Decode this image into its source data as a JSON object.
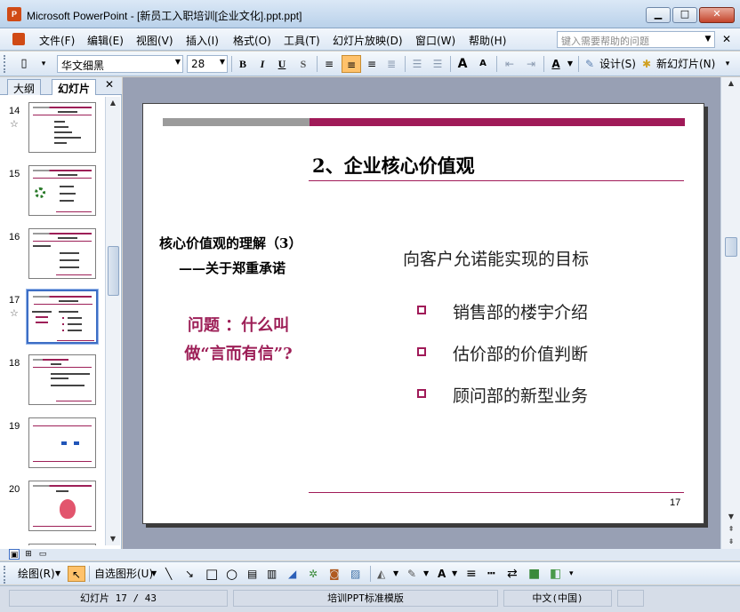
{
  "window": {
    "title": "Microsoft PowerPoint - [新员工入职培训[企业文化].ppt.ppt]",
    "app_icon_text": "P",
    "minimize": "▁",
    "maximize": "□",
    "close": "✕"
  },
  "menu": {
    "items": [
      "文件(F)",
      "编辑(E)",
      "视图(V)",
      "插入(I)",
      "格式(O)",
      "工具(T)",
      "幻灯片放映(D)",
      "窗口(W)",
      "帮助(H)"
    ],
    "help_placeholder": "键入需要帮助的问题",
    "close": "✕"
  },
  "toolbar": {
    "font_name": "华文细黑",
    "font_size": "28",
    "bold": "B",
    "italic": "I",
    "underline": "U",
    "shadow": "S",
    "design_label": "设计(S)",
    "new_slide_label": "新幻灯片(N)",
    "grow_font": "A",
    "shrink_font": "A",
    "font_color": "A"
  },
  "pane": {
    "tab_outline": "大纲",
    "tab_slides": "幻灯片",
    "close": "✕",
    "thumbs": [
      {
        "num": "14",
        "star": "☆"
      },
      {
        "num": "15",
        "star": ""
      },
      {
        "num": "16",
        "star": ""
      },
      {
        "num": "17",
        "star": "☆"
      },
      {
        "num": "18",
        "star": ""
      },
      {
        "num": "19",
        "star": ""
      },
      {
        "num": "20",
        "star": ""
      }
    ]
  },
  "slide": {
    "title": "2、企业核心价值观",
    "left_heading": "核心价值观的理解（3）",
    "left_sub": "——关于郑重承诺",
    "question_line1": "问题 ：什么叫",
    "question_line2": "做“言而有信”?",
    "goal": "向客户允诺能实现的目标",
    "bullets": [
      "销售部的楼宇介绍",
      "估价部的价值判断",
      "顾问部的新型业务"
    ],
    "page_number": "17"
  },
  "drawbar": {
    "draw_label": "绘图(R)",
    "autoshapes_label": "自选图形(U)"
  },
  "status": {
    "slide_info": "幻灯片 17 / 43",
    "template": "培训PPT标准模版",
    "language": "中文(中国)"
  },
  "colors": {
    "accent": "#a01a58",
    "bar_gray": "#9b9b9b",
    "selection": "#3d6ec5"
  }
}
